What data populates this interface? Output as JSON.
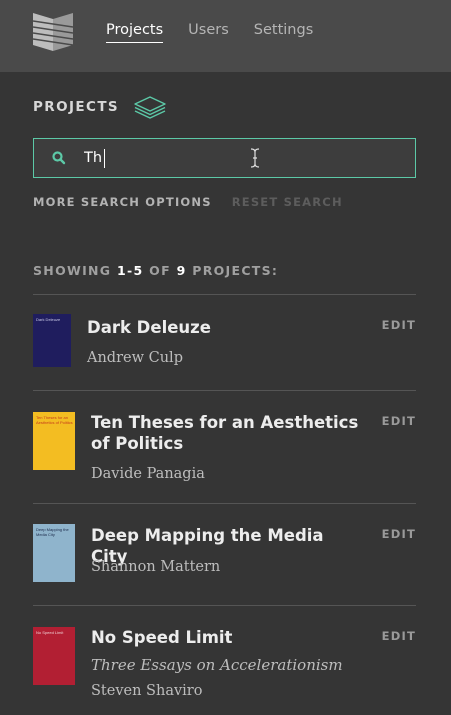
{
  "nav": {
    "projects": "Projects",
    "users": "Users",
    "settings": "Settings"
  },
  "section": {
    "title": "PROJECTS"
  },
  "search": {
    "value": "Th"
  },
  "search_options": {
    "more": "MORE SEARCH OPTIONS",
    "reset": "RESET SEARCH"
  },
  "results": {
    "prefix": "SHOWING ",
    "range": "1-5",
    "of": " OF ",
    "total": "9",
    "suffix": " PROJECTS:"
  },
  "colors": {
    "accent": "#5cc9a7",
    "header_bg": "#4a4a4a",
    "page_bg": "#353535"
  },
  "projects": [
    {
      "title": "Dark Deleuze",
      "subtitle": "",
      "author": "Andrew Culp",
      "edit": "EDIT",
      "cover_color": "#1f1d5e",
      "cover_text": "Dark Deleuze"
    },
    {
      "title": "Ten Theses for an Aesthetics of Politics",
      "subtitle": "",
      "author": "Davide Panagia",
      "edit": "EDIT",
      "cover_color": "#f3bd22",
      "cover_text": "Ten Theses for an Aesthetics of Politics"
    },
    {
      "title": "Deep Mapping the Media City",
      "subtitle": "",
      "author": "Shannon Mattern",
      "edit": "EDIT",
      "cover_color": "#8fb4cc",
      "cover_text": "Deep Mapping the Media City"
    },
    {
      "title": "No Speed Limit",
      "subtitle": "Three Essays on Accelerationism",
      "author": "Steven Shaviro",
      "edit": "EDIT",
      "cover_color": "#b21f33",
      "cover_text": "No Speed Limit"
    }
  ]
}
